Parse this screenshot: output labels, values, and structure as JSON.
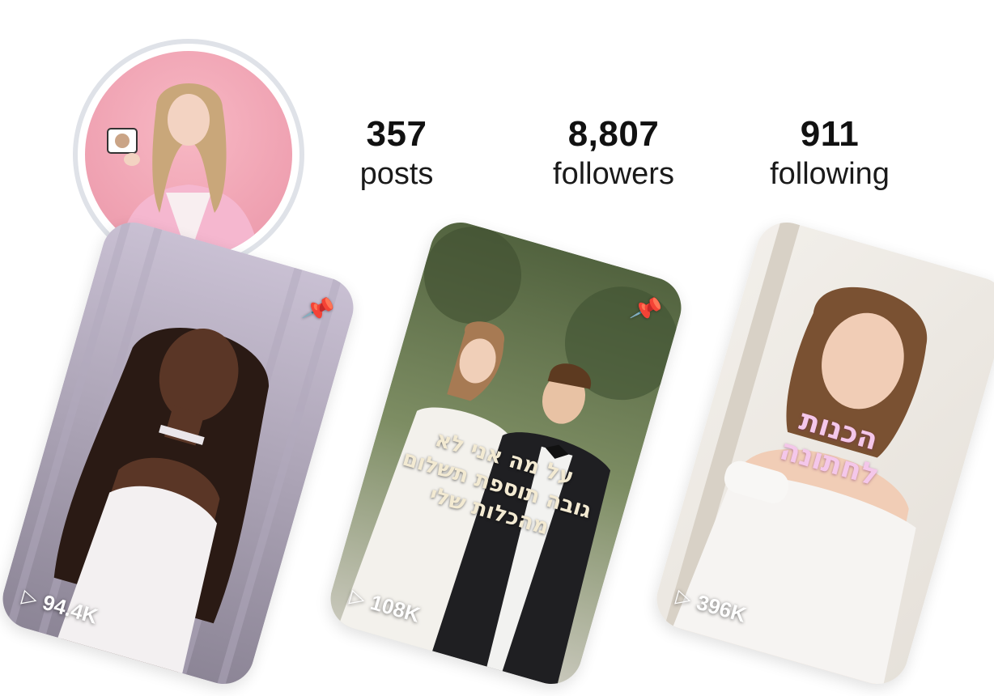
{
  "profile": {
    "avatar_alt": "profile picture"
  },
  "stats": [
    {
      "value": "357",
      "label": "posts"
    },
    {
      "value": "8,807",
      "label": "followers"
    },
    {
      "value": "911",
      "label": "following"
    }
  ],
  "reels": [
    {
      "views": "94.4K",
      "pinned": true,
      "overlay": ""
    },
    {
      "views": "108K",
      "pinned": true,
      "overlay": "על מה אני לא\nגובה תוספת תשלום\nמהכלות שלי"
    },
    {
      "views": "396K",
      "pinned": false,
      "overlay": "הכנות\nלחתונה"
    }
  ],
  "icons": {
    "pin": "pin-icon",
    "play": "play-icon"
  },
  "colors": {
    "avatar_bg": "#f0a3b3",
    "avatar_ring": "#dfe2e8",
    "card2_text": "#f3ead2",
    "card3_text": "#f4c7ea"
  }
}
